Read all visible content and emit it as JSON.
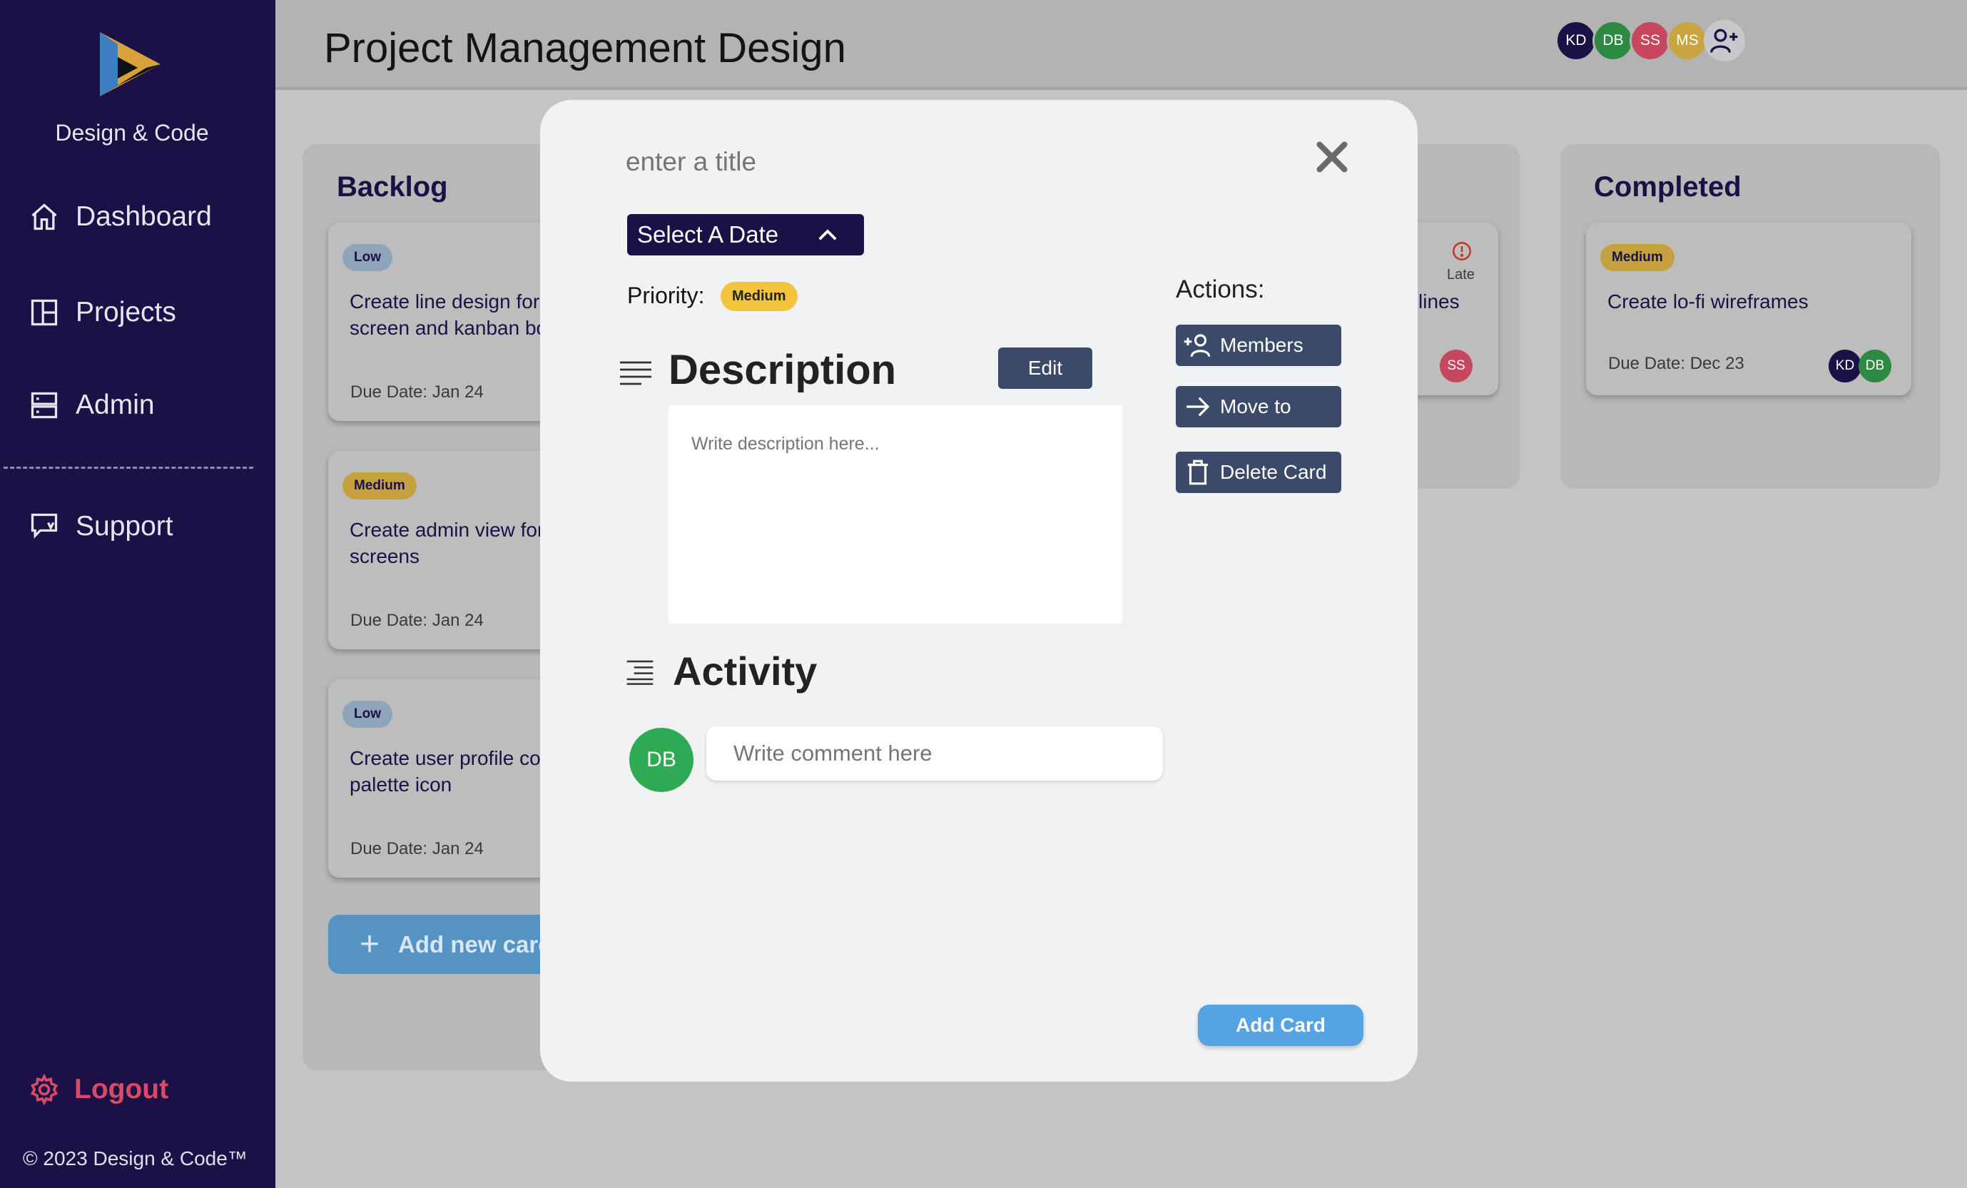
{
  "sidebar": {
    "brand": "Design & Code",
    "nav": [
      {
        "label": "Dashboard",
        "icon": "home-icon"
      },
      {
        "label": "Projects",
        "icon": "layout-icon"
      },
      {
        "label": "Admin",
        "icon": "server-icon"
      },
      {
        "label": "Support",
        "icon": "support-icon"
      }
    ],
    "logout": "Logout",
    "copyright": "© 2023 Design & Code™"
  },
  "header": {
    "title": "Project Management Design",
    "avatars": [
      {
        "initials": "KD",
        "color": "#1b1147"
      },
      {
        "initials": "DB",
        "color": "#2d8a43"
      },
      {
        "initials": "SS",
        "color": "#c7475e"
      },
      {
        "initials": "MS",
        "color": "#c9a440"
      }
    ]
  },
  "board": {
    "backlog": {
      "title": "Backlog",
      "cards": [
        {
          "priority": "Low",
          "title_line1": "Create line design for",
          "title_line2": "screen and kanban bo",
          "due": "Due Date: Jan 24"
        },
        {
          "priority": "Medium",
          "title_line1": "Create admin view for",
          "title_line2": "screens",
          "due": "Due Date: Jan 24"
        },
        {
          "priority": "Low",
          "title_line1": "Create user profile co",
          "title_line2": "palette icon",
          "due": "Due Date: Jan 24"
        }
      ],
      "add_new": "Add new card"
    },
    "hidden_column": {
      "card_text": "lines",
      "late": "Late",
      "avatar": "SS"
    },
    "completed": {
      "title": "Completed",
      "card": {
        "priority": "Medium",
        "title": "Create lo-fi wireframes",
        "due": "Due Date: Dec 23",
        "avatars": [
          "KD",
          "DB"
        ]
      }
    }
  },
  "modal": {
    "title_placeholder": "enter a title",
    "date_button": "Select A Date",
    "priority_label": "Priority:",
    "priority_value": "Medium",
    "description_title": "Description",
    "edit_button": "Edit",
    "description_placeholder": "Write description here...",
    "activity_title": "Activity",
    "comment_avatar": "DB",
    "comment_placeholder": "Write comment here",
    "actions_label": "Actions:",
    "actions": {
      "members": "Members",
      "move_to": "Move to",
      "delete": "Delete Card"
    },
    "add_card": "Add Card"
  },
  "colors": {
    "sidebar": "#1b1147",
    "accent": "#3b4a68",
    "primary_button": "#55a3e3",
    "logout": "#d94b64",
    "priority_medium": "#f2c33c"
  }
}
